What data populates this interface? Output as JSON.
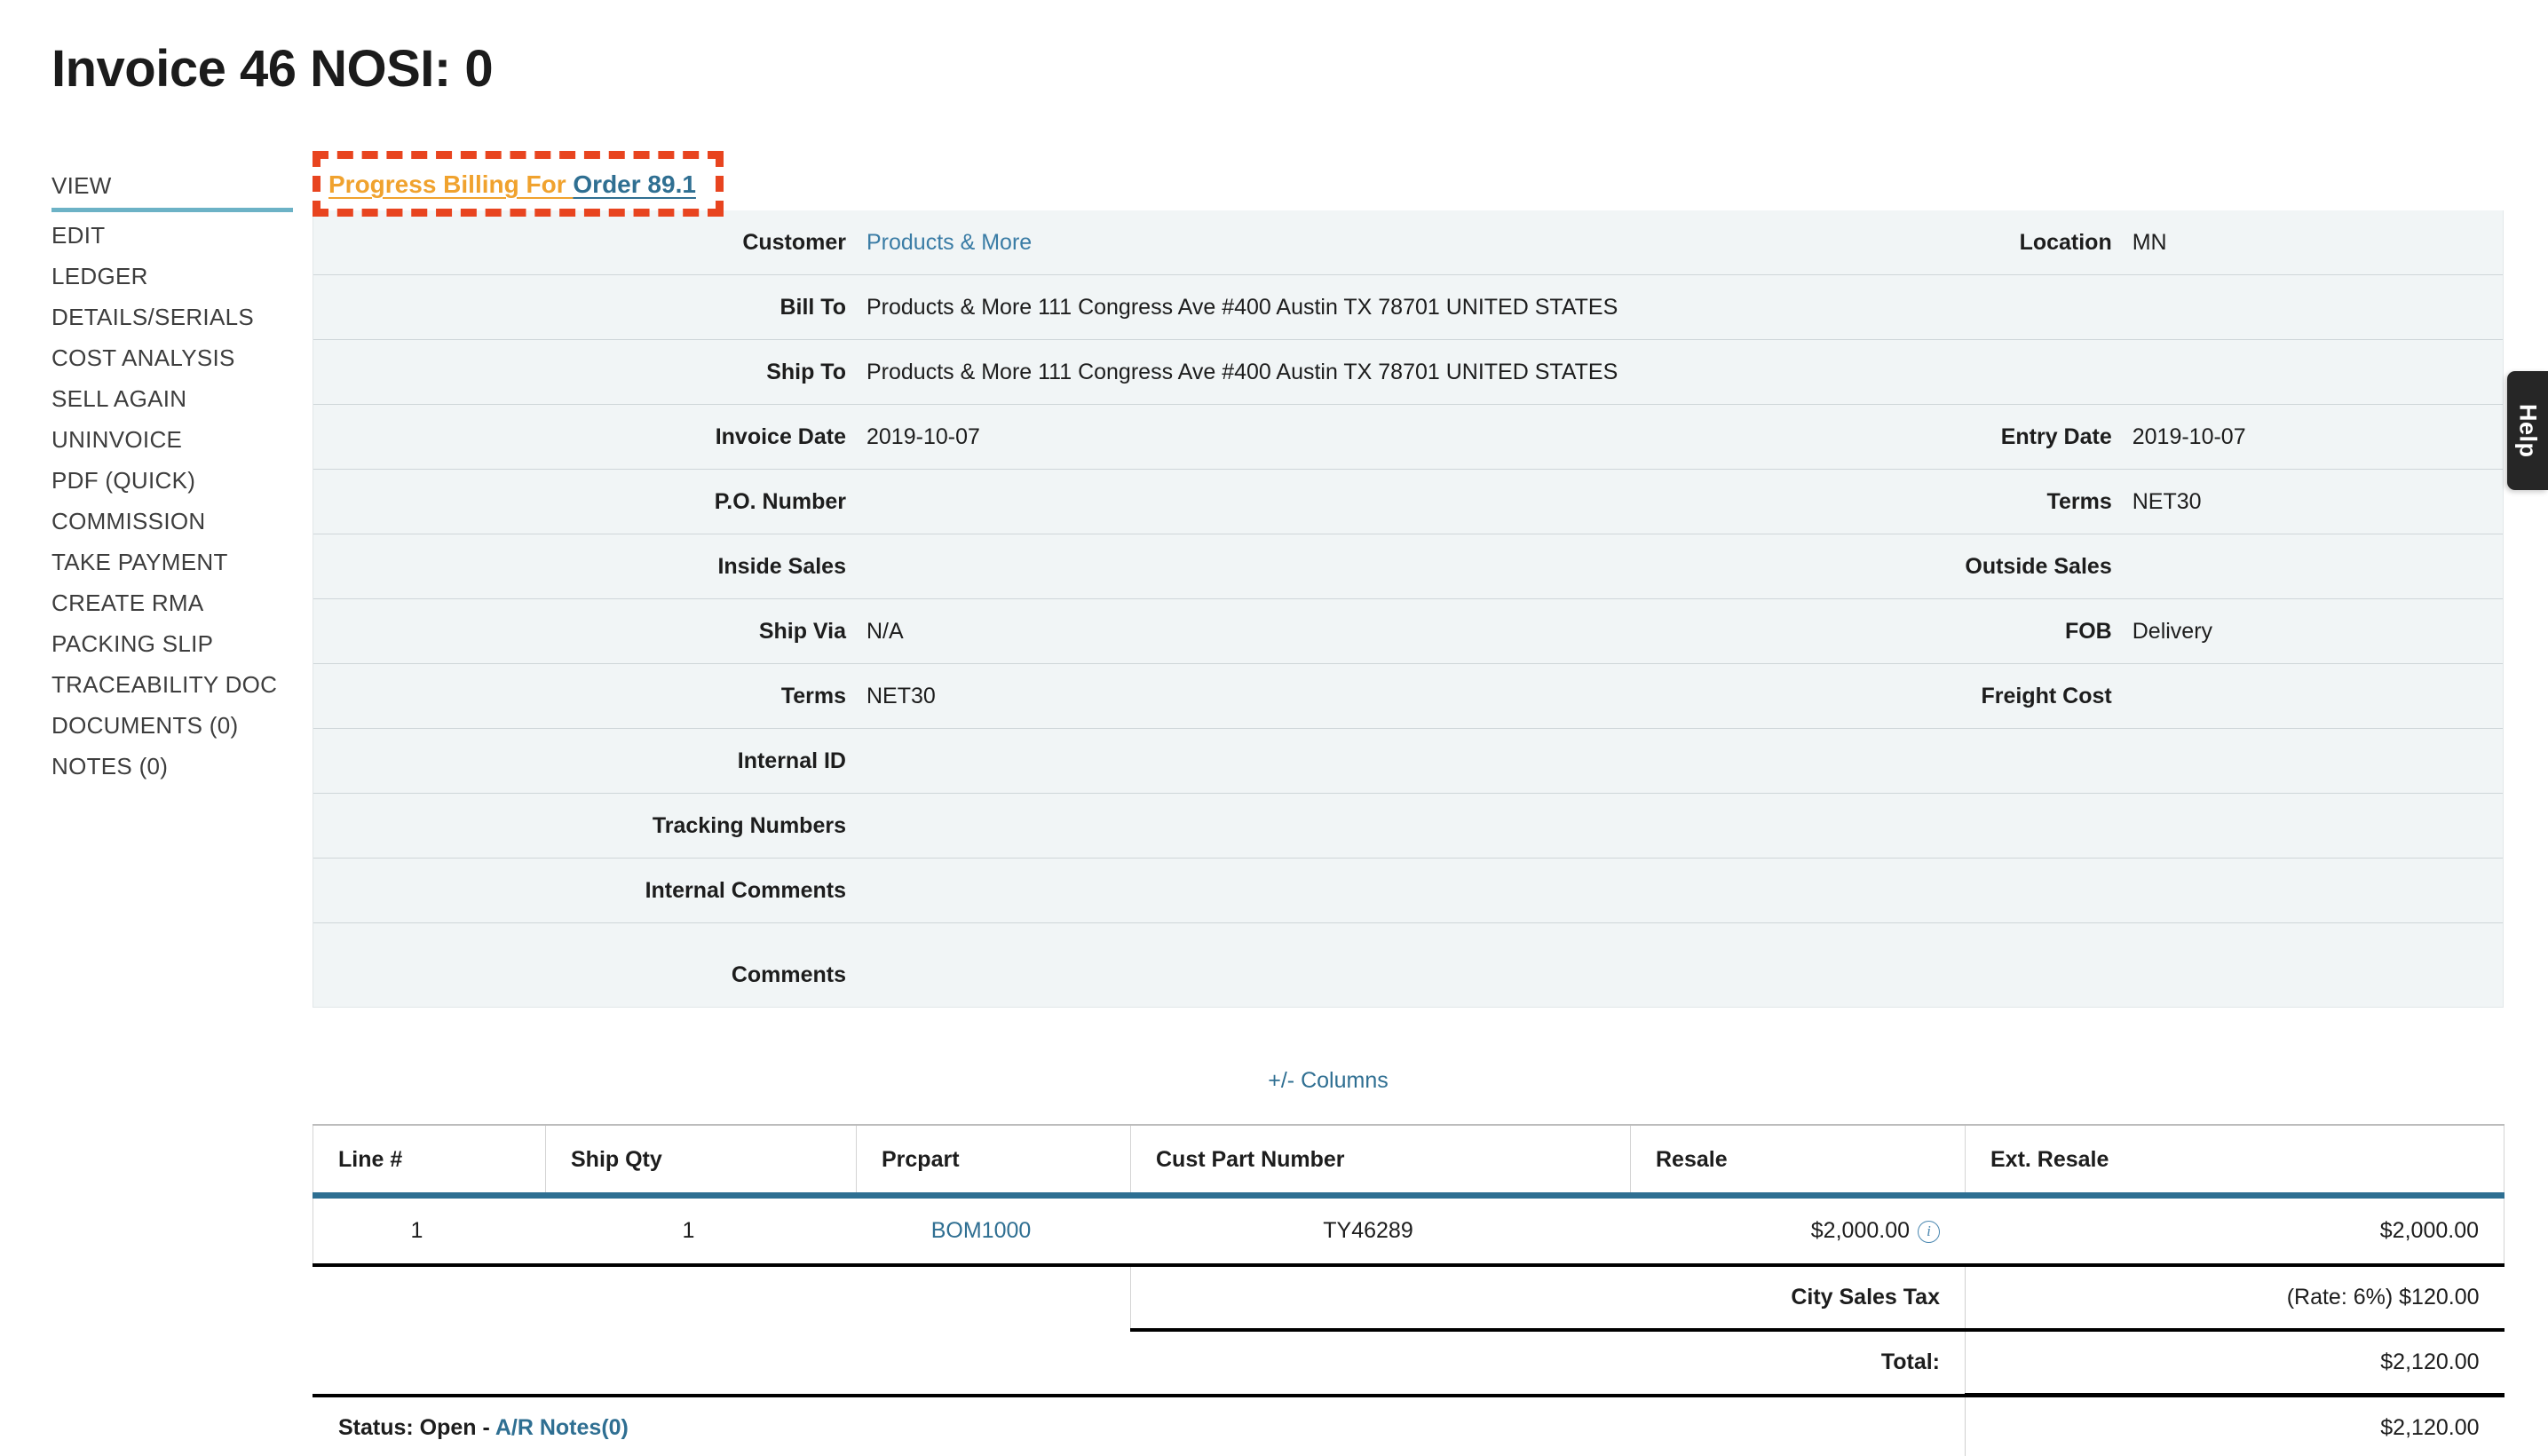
{
  "header": {
    "title": "Invoice 46 NOSI: 0"
  },
  "sidebar": {
    "items": [
      {
        "label": "VIEW",
        "active": true
      },
      {
        "label": "EDIT",
        "active": false
      },
      {
        "label": "LEDGER",
        "active": false
      },
      {
        "label": "DETAILS/SERIALS",
        "active": false
      },
      {
        "label": "COST ANALYSIS",
        "active": false
      },
      {
        "label": "SELL AGAIN",
        "active": false
      },
      {
        "label": "UNINVOICE",
        "active": false
      },
      {
        "label": "PDF (QUICK)",
        "active": false
      },
      {
        "label": "COMMISSION",
        "active": false
      },
      {
        "label": "TAKE PAYMENT",
        "active": false
      },
      {
        "label": "CREATE RMA",
        "active": false
      },
      {
        "label": "PACKING SLIP",
        "active": false
      },
      {
        "label": "TRACEABILITY DOC",
        "active": false
      },
      {
        "label": "DOCUMENTS (0)",
        "active": false
      },
      {
        "label": "NOTES (0)",
        "active": false
      }
    ]
  },
  "banner": {
    "prefix_text": "Progress Billing For ",
    "order_link": "Order 89.1",
    "highlight_color": "#e8441f",
    "prefix_color": "#f0a22e",
    "link_color": "#2f6f92"
  },
  "help_tab": {
    "label": "Help"
  },
  "details": {
    "customer_label": "Customer",
    "customer_value": "Products & More",
    "location_label": "Location",
    "location_value": "MN",
    "bill_to_label": "Bill To",
    "bill_to_value": "Products & More 111 Congress Ave #400 Austin TX 78701 UNITED STATES",
    "ship_to_label": "Ship To",
    "ship_to_value": "Products & More 111 Congress Ave #400 Austin TX 78701 UNITED STATES",
    "invoice_date_label": "Invoice Date",
    "invoice_date_value": "2019-10-07",
    "entry_date_label": "Entry Date",
    "entry_date_value": "2019-10-07",
    "po_number_label": "P.O. Number",
    "po_number_value": "",
    "terms_right_label": "Terms",
    "terms_right_value": "NET30",
    "inside_sales_label": "Inside Sales",
    "inside_sales_value": "",
    "outside_sales_label": "Outside Sales",
    "outside_sales_value": "",
    "ship_via_label": "Ship Via",
    "ship_via_value": "N/A",
    "fob_label": "FOB",
    "fob_value": "Delivery",
    "terms_label": "Terms",
    "terms_value": "NET30",
    "freight_cost_label": "Freight Cost",
    "freight_cost_value": "",
    "internal_id_label": "Internal ID",
    "internal_id_value": "",
    "tracking_numbers_label": "Tracking Numbers",
    "tracking_numbers_value": "",
    "internal_comments_label": "Internal Comments",
    "internal_comments_value": "",
    "comments_label": "Comments",
    "comments_value": ""
  },
  "columns_toggle": {
    "label": "+/- Columns"
  },
  "items": {
    "headers": [
      "Line #",
      "Ship Qty",
      "Prcpart",
      "Cust Part Number",
      "Resale",
      "Ext. Resale"
    ],
    "rows": [
      {
        "line": "1",
        "ship_qty": "1",
        "prcpart": "BOM1000",
        "cust_part_number": "TY46289",
        "resale": "$2,000.00",
        "resale_has_info_icon": true,
        "ext_resale": "$2,000.00"
      }
    ]
  },
  "totals": {
    "tax_label": "City Sales Tax",
    "tax_value": "(Rate: 6%) $120.00",
    "total_label": "Total:",
    "total_value": "$2,120.00",
    "status_text": "Status: Open - ",
    "ar_notes_label": "A/R Notes(0)",
    "balance_value": "$2,120.00"
  }
}
